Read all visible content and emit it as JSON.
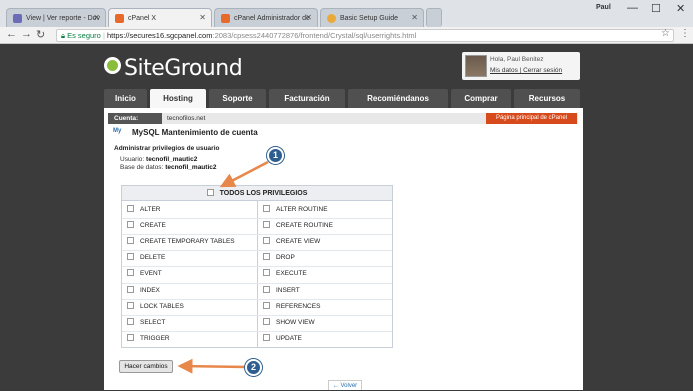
{
  "browser": {
    "tabs": [
      {
        "title": "View | Ver reporte - Dov",
        "icon_color": "#6b6bb8"
      },
      {
        "title": "cPanel X",
        "icon_color": "#e86a2a"
      },
      {
        "title": "cPanel Administrador de",
        "icon_color": "#e86a2a"
      },
      {
        "title": "Basic Setup Guide",
        "icon_color": "#e9a93b"
      }
    ],
    "user_chip": "Paul",
    "controls": {
      "minimize": "—",
      "maximize": "☐",
      "close": "✕"
    },
    "address": {
      "secure_label": "Es seguro",
      "url_host": "https://secures16.sgcpanel.com",
      "url_path": ":2083/cpsess2440772876/frontend/Crystal/sql/userrights.html"
    }
  },
  "header": {
    "logo": "SiteGround",
    "user": {
      "greeting": "Hola, Paul Benitez",
      "links": "Mis datos  |  Cerrar sesión"
    }
  },
  "menu": [
    "Inicio",
    "Hosting",
    "Soporte",
    "Facturación",
    "Recomiéndanos",
    "Comprar",
    "Recursos"
  ],
  "account": {
    "label": "Cuenta:",
    "value": "tecnofilos.net",
    "cpanel_button": "Página principal de cPanel"
  },
  "page": {
    "icon_text": "My",
    "title": "MySQL Mantenimiento de cuenta",
    "subtitle": "Administrar privilegios de usuario",
    "user_label": "Usuario:",
    "user_value": "tecnofil_mautic2",
    "db_label": "Base de datos:",
    "db_value": "tecnofil_mautic2"
  },
  "privileges": {
    "header": "TODOS LOS PRIVILEGIOS",
    "left": [
      "ALTER",
      "CREATE",
      "CREATE TEMPORARY TABLES",
      "DELETE",
      "EVENT",
      "INDEX",
      "LOCK TABLES",
      "SELECT",
      "TRIGGER"
    ],
    "right": [
      "ALTER ROUTINE",
      "CREATE ROUTINE",
      "CREATE VIEW",
      "DROP",
      "EXECUTE",
      "INSERT",
      "REFERENCES",
      "SHOW VIEW",
      "UPDATE"
    ]
  },
  "actions": {
    "submit": "Hacer cambios",
    "back": "← Volver"
  },
  "callouts": [
    "1",
    "2"
  ],
  "colors": {
    "accent": "#d64a1c",
    "callout": "#2e5e8f",
    "arrow": "#e8874a"
  }
}
